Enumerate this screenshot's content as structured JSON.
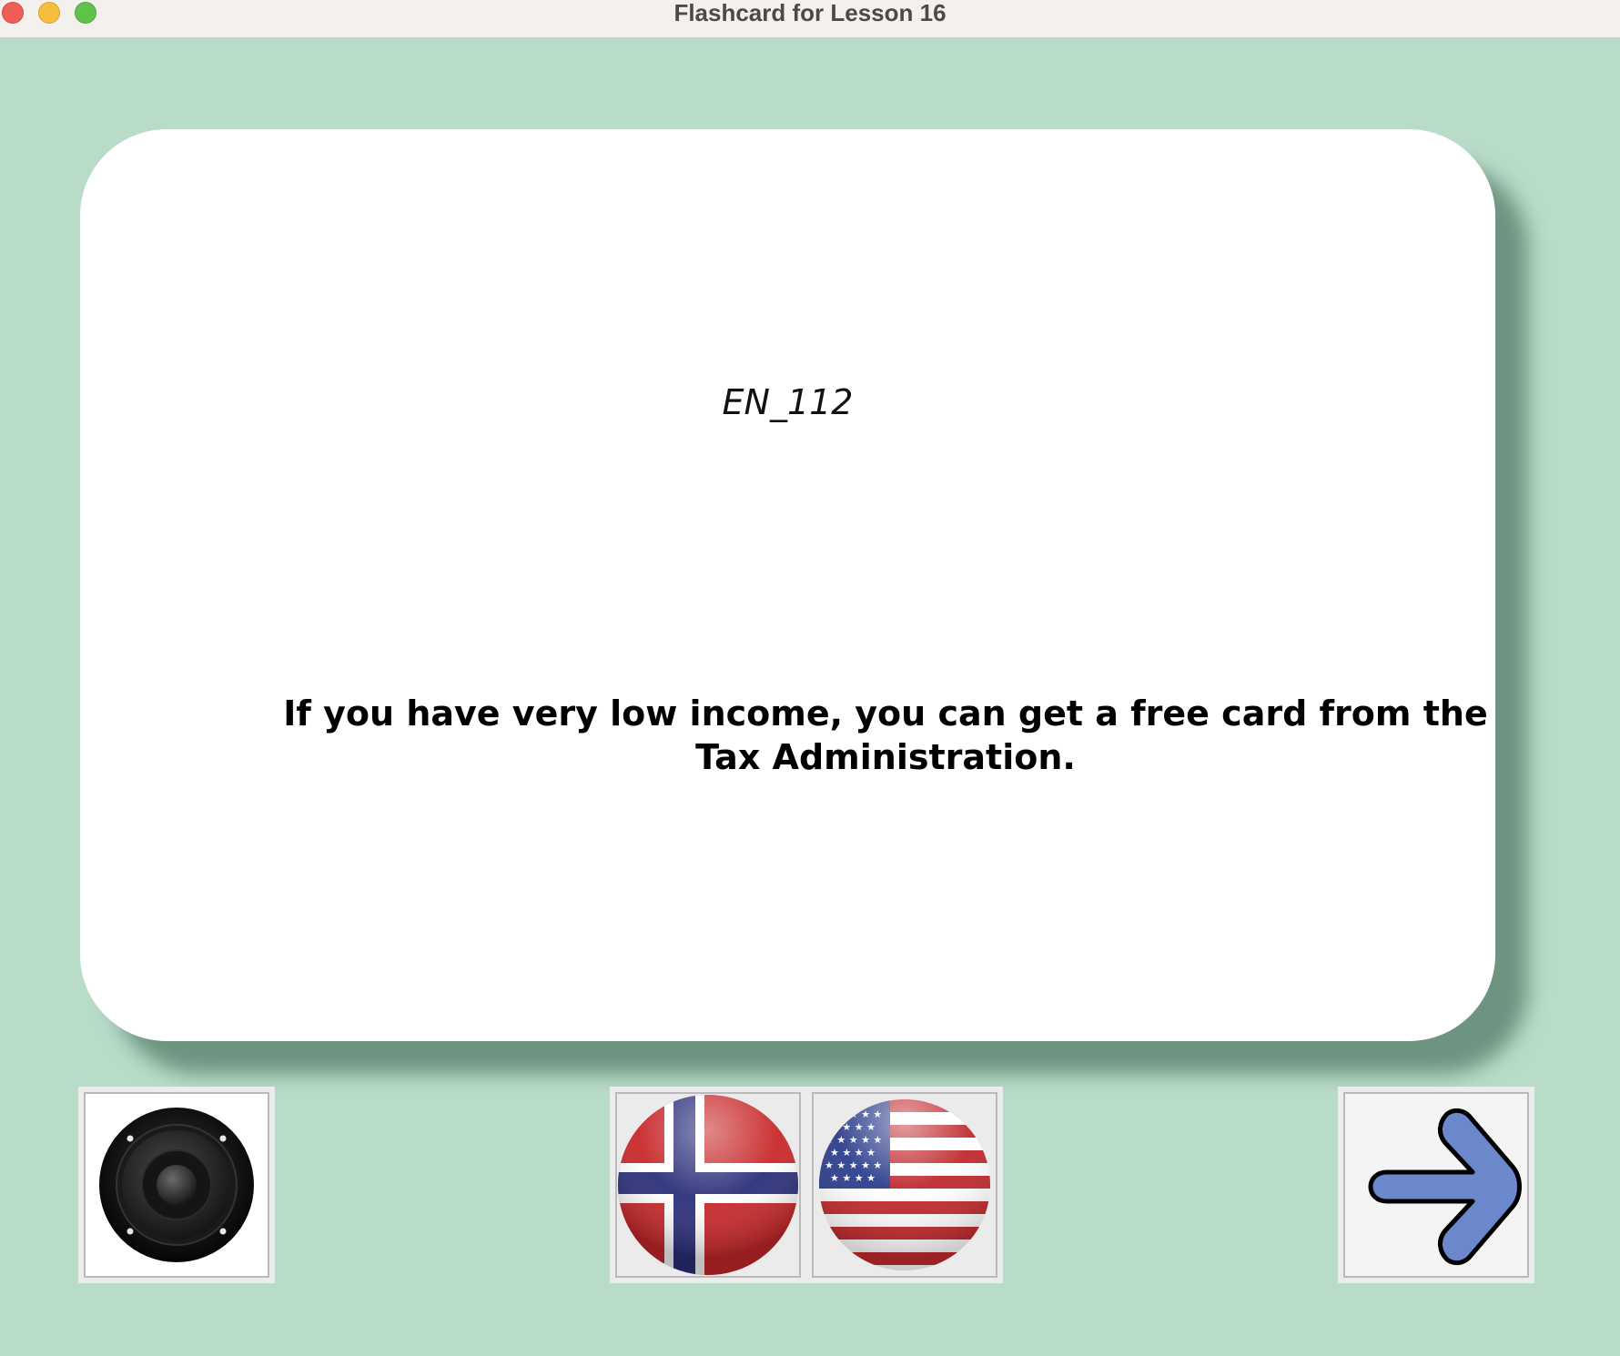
{
  "window": {
    "title": "Flashcard for Lesson 16"
  },
  "card": {
    "id": "EN_112",
    "sentence": "If you have very low income, you can get a free card from the Tax Administration."
  },
  "controls": {
    "speaker_icon": "speaker-icon",
    "norwegian_flag_icon": "norway-flag-icon",
    "us_flag_icon": "us-flag-icon",
    "next_icon": "arrow-right-icon"
  },
  "colors": {
    "background": "#b9dcc9",
    "card": "#ffffff",
    "arrow": "#6b88cc",
    "norway_red": "#c8282a",
    "norway_blue": "#2b2f7a"
  }
}
